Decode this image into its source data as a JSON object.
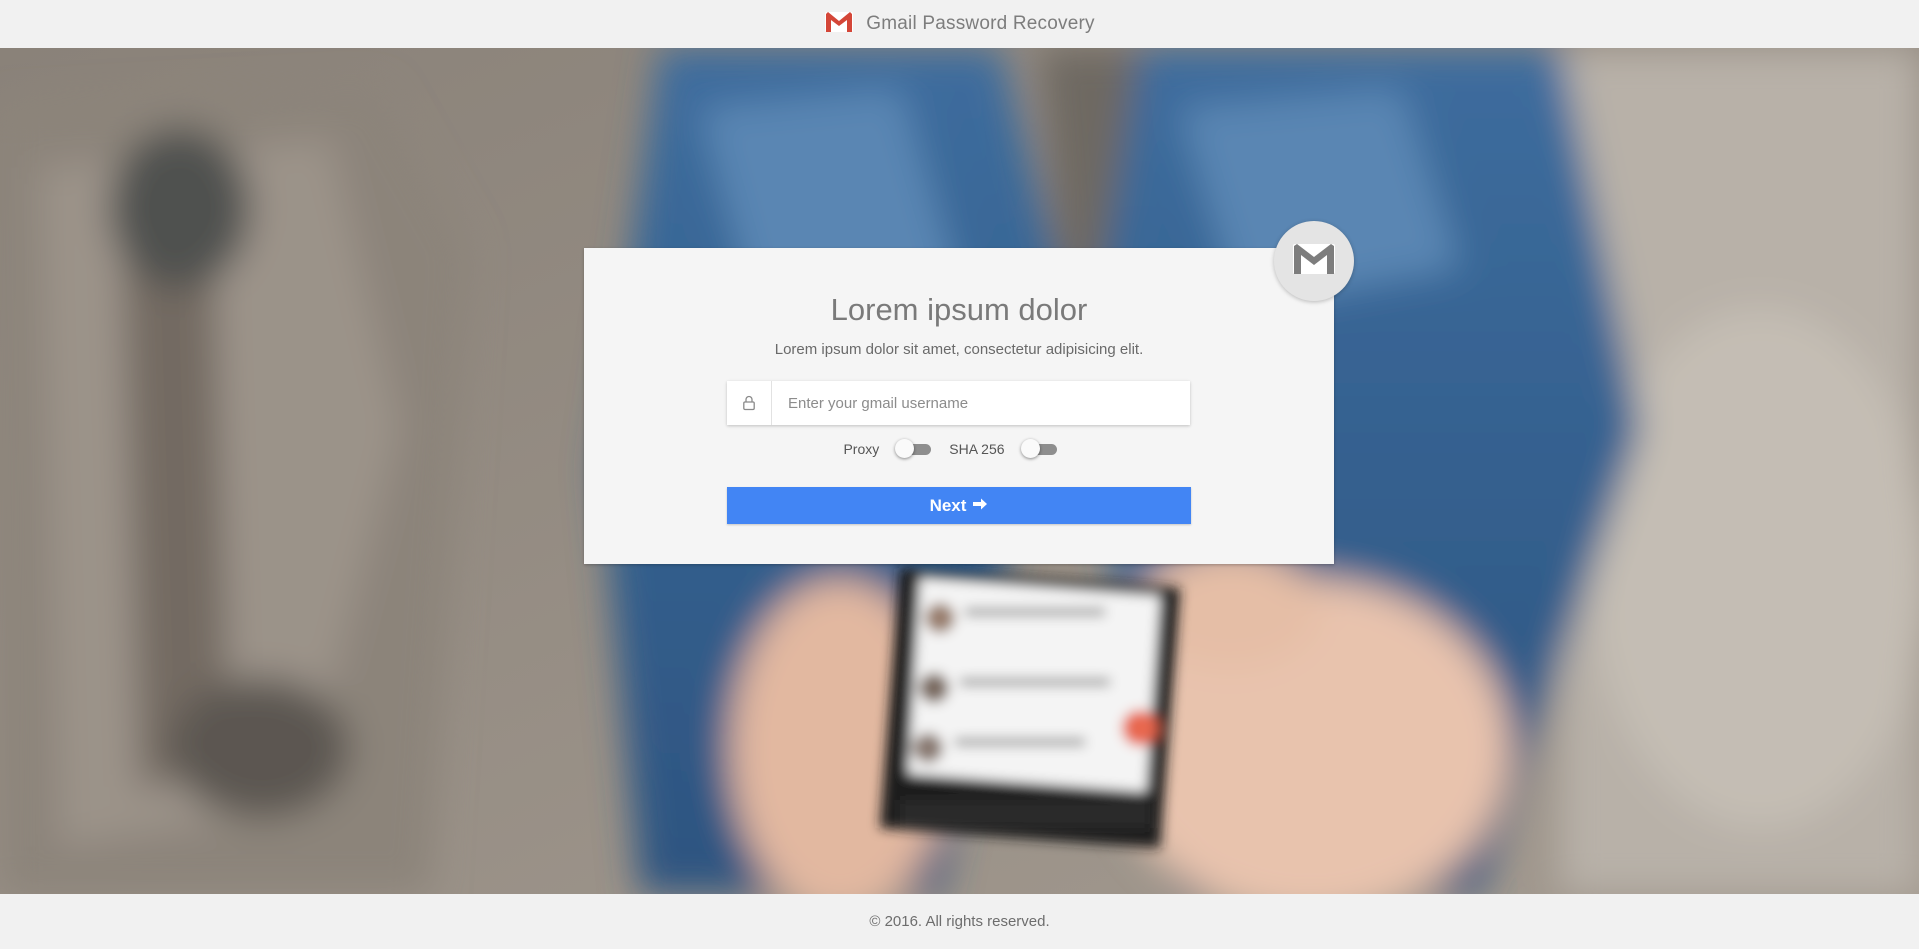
{
  "header": {
    "title": "Gmail Password Recovery",
    "logo_icon": "gmail-m-icon",
    "brand_color": "#d44638"
  },
  "card": {
    "title": "Lorem ipsum dolor",
    "subtitle": "Lorem ipsum dolor sit amet, consectetur adipisicing elit.",
    "badge_icon": "gmail-m-icon",
    "username_field": {
      "icon": "lock-icon",
      "placeholder": "Enter your gmail username",
      "value": ""
    },
    "toggles": [
      {
        "label": "Proxy",
        "on": false
      },
      {
        "label": "SHA 256",
        "on": false
      }
    ],
    "next_button": {
      "label": "Next",
      "icon": "arrow-right-icon",
      "color": "#4285f4"
    }
  },
  "footer": {
    "copyright": "© 2016. All rights reserved."
  }
}
